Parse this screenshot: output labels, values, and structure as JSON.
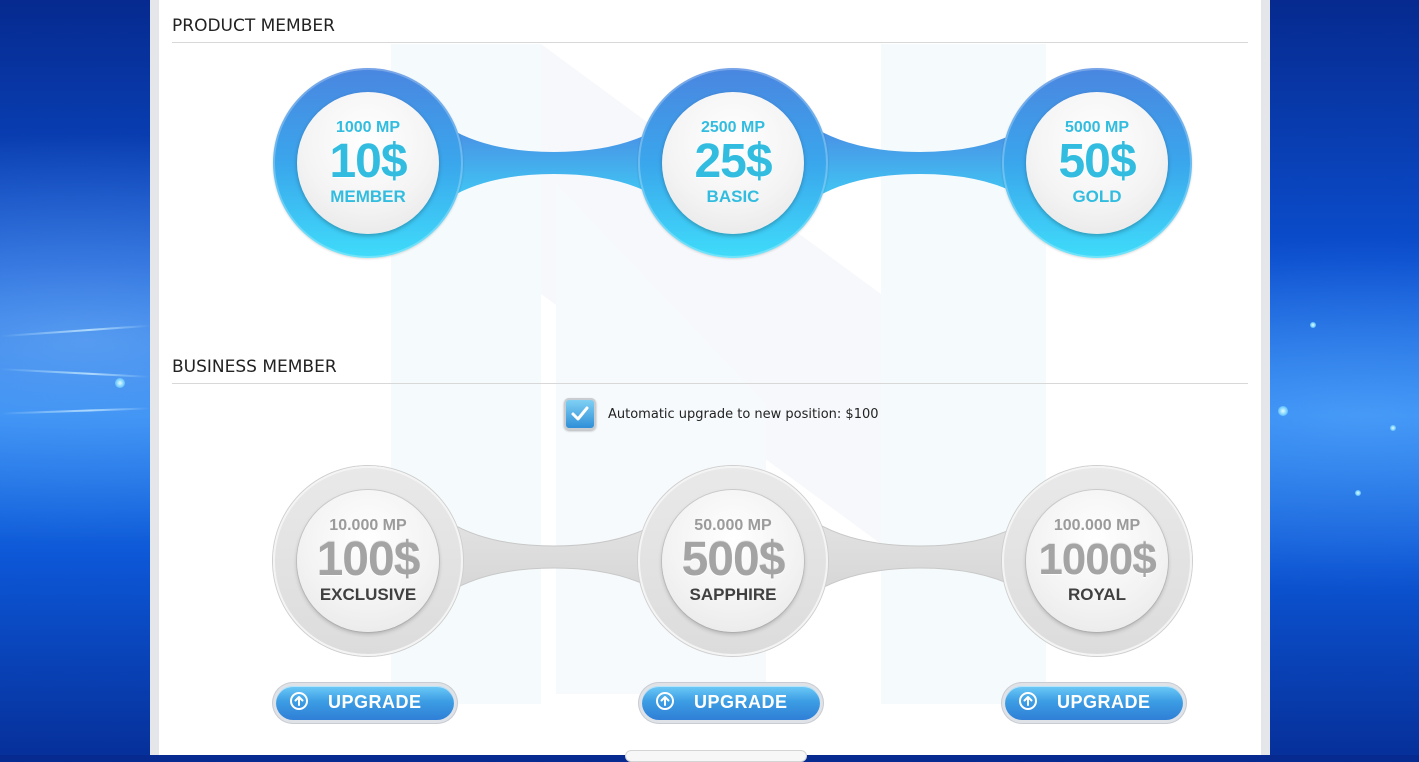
{
  "product_section": {
    "title": "PRODUCT MEMBER",
    "tiers": [
      {
        "mp": "1000 MP",
        "price": "10$",
        "name": "MEMBER"
      },
      {
        "mp": "2500 MP",
        "price": "25$",
        "name": "BASIC"
      },
      {
        "mp": "5000 MP",
        "price": "50$",
        "name": "GOLD"
      }
    ]
  },
  "business_section": {
    "title": "BUSINESS MEMBER",
    "auto_upgrade": {
      "checked": true,
      "label": "Automatic upgrade to new position: $100"
    },
    "tiers": [
      {
        "mp": "10.000 MP",
        "price": "100$",
        "name": "EXCLUSIVE",
        "button": "UPGRADE"
      },
      {
        "mp": "50.000 MP",
        "price": "500$",
        "name": "SAPPHIRE",
        "button": "UPGRADE"
      },
      {
        "mp": "100.000 MP",
        "price": "1000$",
        "name": "ROYAL",
        "button": "UPGRADE"
      }
    ]
  },
  "icons": {
    "checkbox": "checkmark-icon",
    "upgrade_button": "arrow-up-circle-icon"
  },
  "colors": {
    "accent_blue": "#3aa6ec",
    "tier_text_blue": "#32bde0",
    "tier_gray": "#dcdcdc",
    "button_blue": "#3c9de4"
  }
}
